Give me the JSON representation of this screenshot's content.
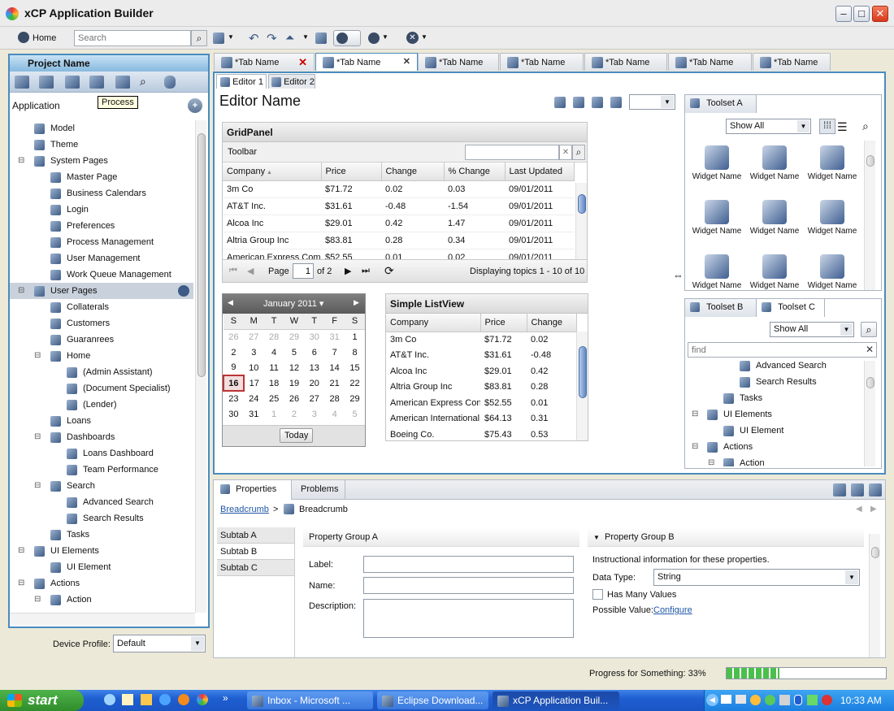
{
  "window": {
    "title": "xCP Application Builder"
  },
  "toolbar": {
    "home_label": "Home",
    "search_placeholder": "Search"
  },
  "left": {
    "project_name": "Project Name",
    "tooltip": "Process",
    "application_label": "Application",
    "tree": [
      {
        "label": "Model",
        "level": 1
      },
      {
        "label": "Theme",
        "level": 1
      },
      {
        "label": "System Pages",
        "level": 1
      },
      {
        "label": "Master Page",
        "level": 2
      },
      {
        "label": "Business Calendars",
        "level": 2
      },
      {
        "label": "Login",
        "level": 2
      },
      {
        "label": "Preferences",
        "level": 2
      },
      {
        "label": "Process Management",
        "level": 2
      },
      {
        "label": "User Management",
        "level": 2
      },
      {
        "label": "Work Queue Management",
        "level": 2
      },
      {
        "label": "User Pages",
        "level": 1
      },
      {
        "label": "Collaterals",
        "level": 2
      },
      {
        "label": "Customers",
        "level": 2
      },
      {
        "label": "Guaranrees",
        "level": 2
      },
      {
        "label": "Home",
        "level": 2
      },
      {
        "label": "(Admin Assistant)",
        "level": 3
      },
      {
        "label": "(Document Specialist)",
        "level": 3
      },
      {
        "label": "(Lender)",
        "level": 3
      },
      {
        "label": "Loans",
        "level": 2
      },
      {
        "label": "Dashboards",
        "level": 2
      },
      {
        "label": "Loans Dashboard",
        "level": 3
      },
      {
        "label": "Team Performance",
        "level": 3
      },
      {
        "label": "Search",
        "level": 2
      },
      {
        "label": "Advanced Search",
        "level": 3
      },
      {
        "label": "Search Results",
        "level": 3
      },
      {
        "label": "Tasks",
        "level": 2
      },
      {
        "label": "UI Elements",
        "level": 1
      },
      {
        "label": "UI Element",
        "level": 2
      },
      {
        "label": "Actions",
        "level": 1
      },
      {
        "label": "Action",
        "level": 2
      }
    ],
    "device_profile_label": "Device Profile:",
    "device_profile_value": "Default"
  },
  "tabs": [
    "*Tab Name",
    "*Tab Name",
    "*Tab Name",
    "*Tab Name",
    "*Tab Name",
    "*Tab Name",
    "*Tab Name"
  ],
  "editor": {
    "subtabs": [
      "Editor 1",
      "Editor 2"
    ],
    "name": "Editor Name",
    "grid": {
      "title": "GridPanel",
      "toolbar_label": "Toolbar",
      "columns": [
        "Company",
        "Price",
        "Change",
        "% Change",
        "Last Updated"
      ],
      "rows": [
        [
          "3m Co",
          "$71.72",
          "0.02",
          "0.03",
          "09/01/2011"
        ],
        [
          "AT&T Inc.",
          "$31.61",
          "-0.48",
          "-1.54",
          "09/01/2011"
        ],
        [
          "Alcoa Inc",
          "$29.01",
          "0.42",
          "1.47",
          "09/01/2011"
        ],
        [
          "Altria Group Inc",
          "$83.81",
          "0.28",
          "0.34",
          "09/01/2011"
        ],
        [
          "American Express Com",
          "$52.55",
          "0.01",
          "0.02",
          "09/01/2011"
        ]
      ],
      "page_label": "Page",
      "page_value": "1",
      "of_label": "of 2",
      "displaying": "Displaying topics 1 - 10 of 10"
    },
    "calendar": {
      "month": "January 2011",
      "weekdays": [
        "S",
        "M",
        "T",
        "W",
        "T",
        "F",
        "S"
      ],
      "weeks": [
        [
          "26",
          "27",
          "28",
          "29",
          "30",
          "31",
          "1"
        ],
        [
          "2",
          "3",
          "4",
          "5",
          "6",
          "7",
          "8"
        ],
        [
          "9",
          "10",
          "11",
          "12",
          "13",
          "14",
          "15"
        ],
        [
          "16",
          "17",
          "18",
          "19",
          "20",
          "21",
          "22"
        ],
        [
          "23",
          "24",
          "25",
          "26",
          "27",
          "28",
          "29"
        ],
        [
          "30",
          "31",
          "1",
          "2",
          "3",
          "4",
          "5"
        ]
      ],
      "today_button": "Today"
    },
    "listview": {
      "title": "Simple ListView",
      "columns": [
        "Company",
        "Price",
        "Change"
      ],
      "rows": [
        [
          "3m Co",
          "$71.72",
          "0.02"
        ],
        [
          "AT&T Inc.",
          "$31.61",
          "-0.48"
        ],
        [
          "Alcoa Inc",
          "$29.01",
          "0.42"
        ],
        [
          "Altria Group Inc",
          "$83.81",
          "0.28"
        ],
        [
          "American Express Con",
          "$52.55",
          "0.01"
        ],
        [
          "American International",
          "$64.13",
          "0.31"
        ],
        [
          "Boeing Co.",
          "$75.43",
          "0.53"
        ]
      ]
    }
  },
  "toolsetA": {
    "title": "Toolset A",
    "filter": "Show All",
    "widgets": [
      "Widget Name",
      "Widget Name",
      "Widget Name",
      "Widget Name",
      "Widget Name",
      "Widget Name",
      "Widget Name",
      "Widget Name",
      "Widget Name"
    ]
  },
  "toolsetBC": {
    "tabs": [
      "Toolset B",
      "Toolset C"
    ],
    "filter": "Show All",
    "find_placeholder": "find",
    "tree": [
      {
        "label": "Advanced Search",
        "level": 3
      },
      {
        "label": "Search Results",
        "level": 3
      },
      {
        "label": "Tasks",
        "level": 2
      },
      {
        "label": "UI Elements",
        "level": 1
      },
      {
        "label": "UI Element",
        "level": 2
      },
      {
        "label": "Actions",
        "level": 1
      },
      {
        "label": "Action",
        "level": 2
      }
    ]
  },
  "bottom": {
    "tabs": [
      "Properties",
      "Problems"
    ],
    "breadcrumb_link": "Breadcrumb",
    "breadcrumb_current": "Breadcrumb",
    "subtabs": [
      "Subtab A",
      "Subtab B",
      "Subtab C"
    ],
    "groupA": {
      "title": "Property Group A",
      "label": "Label:",
      "name": "Name:",
      "description": "Description:"
    },
    "groupB": {
      "title": "Property Group B",
      "info": "Instructional information for these properties.",
      "data_type_label": "Data Type:",
      "data_type_value": "String",
      "has_many": "Has Many Values",
      "possible_label": "Possible Value:",
      "possible_link": "Configure"
    }
  },
  "status": {
    "progress_text": "Progress for Something: 33%",
    "progress": 0.33
  },
  "taskbar": {
    "start": "start",
    "items": [
      "Inbox - Microsoft ...",
      "Eclipse Download...",
      "xCP Application Buil..."
    ],
    "clock": "10:33 AM"
  },
  "colors": {
    "accent": "#4a8bbf",
    "taskbar": "#245edb",
    "start": "#3c9a37",
    "link": "#1f57a8"
  }
}
